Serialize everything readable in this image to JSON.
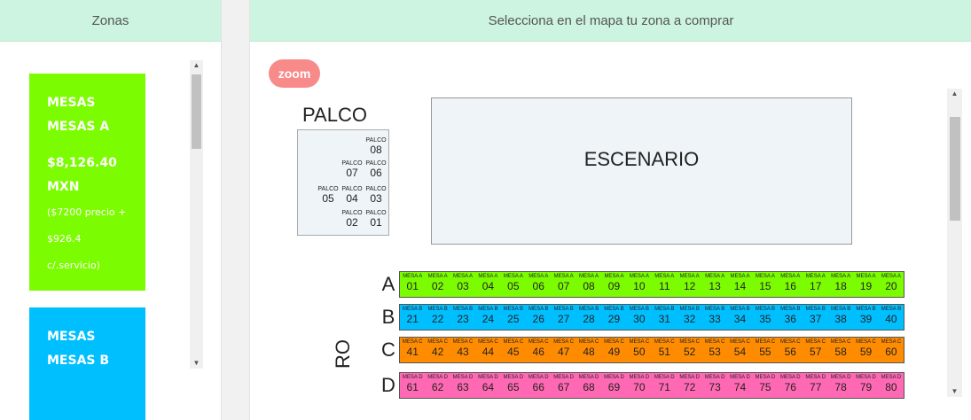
{
  "left_panel": {
    "header": "Zonas",
    "zones": [
      {
        "line1": "MESAS",
        "line2": "MESAS A",
        "price": "$8,126.40",
        "currency": "MXN",
        "detail1": "($7200 precio +",
        "detail2": "$926.4",
        "detail3": "c/.servicio)",
        "color": "#7cfc00"
      },
      {
        "line1": "MESAS",
        "line2": "MESAS B",
        "color": "#00bfff"
      }
    ]
  },
  "right_panel": {
    "header": "Selecciona en el mapa tu zona a comprar",
    "zoom_label": "zoom",
    "palco_title": "PALCO",
    "palco_seat_label": "PALCO",
    "palco_seats": [
      "08",
      "07",
      "06",
      "05",
      "04",
      "03",
      "02",
      "01"
    ],
    "stage_label": "ESCENARIO",
    "rows": [
      {
        "letter": "A",
        "seat_label": "MESA A",
        "color": "#7cfc00",
        "seats": [
          "01",
          "02",
          "03",
          "04",
          "05",
          "06",
          "07",
          "08",
          "09",
          "10",
          "11",
          "12",
          "13",
          "14",
          "15",
          "16",
          "17",
          "18",
          "19",
          "20"
        ]
      },
      {
        "letter": "B",
        "seat_label": "MESA B",
        "color": "#00bfff",
        "seats": [
          "21",
          "22",
          "23",
          "24",
          "25",
          "26",
          "27",
          "28",
          "29",
          "30",
          "31",
          "32",
          "33",
          "34",
          "35",
          "36",
          "37",
          "38",
          "39",
          "40"
        ]
      },
      {
        "letter": "C",
        "seat_label": "MESA C",
        "color": "#ff8c00",
        "seats": [
          "41",
          "42",
          "43",
          "44",
          "45",
          "46",
          "47",
          "48",
          "49",
          "50",
          "51",
          "52",
          "53",
          "54",
          "55",
          "56",
          "57",
          "58",
          "59",
          "60"
        ]
      },
      {
        "letter": "D",
        "seat_label": "MESA D",
        "color": "#ff69b4",
        "seats": [
          "61",
          "62",
          "63",
          "64",
          "65",
          "66",
          "67",
          "68",
          "69",
          "70",
          "71",
          "72",
          "73",
          "74",
          "75",
          "76",
          "77",
          "78",
          "79",
          "80"
        ]
      }
    ],
    "partial_side_label": "RO"
  },
  "icons": {
    "scroll_up": "triangle-up-icon",
    "scroll_down": "triangle-down-icon"
  }
}
